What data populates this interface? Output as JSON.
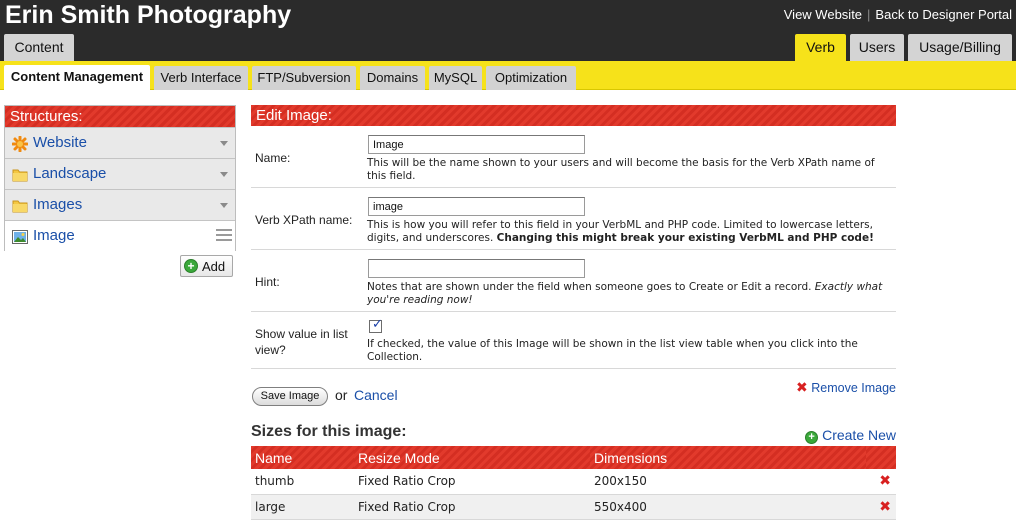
{
  "header": {
    "site_title": "Erin Smith Photography",
    "view_website": "View Website",
    "back_portal": "Back to Designer Portal",
    "tabs_left": [
      {
        "label": "Content",
        "active": false
      }
    ],
    "tabs_right": [
      {
        "label": "Verb",
        "active": true
      },
      {
        "label": "Users",
        "active": false
      },
      {
        "label": "Usage/Billing",
        "active": false
      }
    ]
  },
  "subnav": {
    "tabs": [
      {
        "label": "Content Management",
        "active": true
      },
      {
        "label": "Verb Interface"
      },
      {
        "label": "FTP/Subversion"
      },
      {
        "label": "Domains"
      },
      {
        "label": "MySQL"
      },
      {
        "label": "Optimization"
      }
    ]
  },
  "sidebar": {
    "title": "Structures:",
    "items": [
      {
        "label": "Website",
        "icon": "website-icon"
      },
      {
        "label": "Landscape",
        "icon": "folder-icon"
      },
      {
        "label": "Images",
        "icon": "folder-icon"
      },
      {
        "label": "Image",
        "icon": "image-icon",
        "selected": true
      }
    ],
    "add_label": "Add"
  },
  "edit": {
    "title": "Edit Image:",
    "name": {
      "label": "Name:",
      "value": "Image",
      "help": "This will be the name shown to your users and will become the basis for the Verb XPath name of this field."
    },
    "xpath": {
      "label": "Verb XPath name:",
      "value": "image",
      "help": "This is how you will refer to this field in your VerbML and PHP code. Limited to lowercase letters, digits, and underscores.",
      "warning": "Changing this might break your existing VerbML and PHP code!"
    },
    "hint": {
      "label": "Hint:",
      "value": "",
      "help": "Notes that are shown under the field when someone goes to Create or Edit a record.",
      "help_em": "Exactly what you're reading now!"
    },
    "show_list": {
      "label": "Show value in list view?",
      "checked": true,
      "help": "If checked, the value of this Image will be shown in the list view table when you click into the Collection."
    },
    "save_label": "Save Image",
    "or_text": "or",
    "cancel_label": "Cancel",
    "remove_label": "Remove Image"
  },
  "sizes": {
    "title": "Sizes for this image:",
    "create_label": "Create New",
    "columns": [
      "Name",
      "Resize Mode",
      "Dimensions"
    ],
    "rows": [
      {
        "name": "thumb",
        "mode": "Fixed Ratio Crop",
        "dims": "200x150"
      },
      {
        "name": "large",
        "mode": "Fixed Ratio Crop",
        "dims": "550x400"
      }
    ]
  },
  "colors": {
    "header_bg": "#2b2b2b",
    "accent_yellow": "#f6e21a",
    "accent_red": "#e23a2c",
    "link_blue": "#1a4fa8"
  }
}
